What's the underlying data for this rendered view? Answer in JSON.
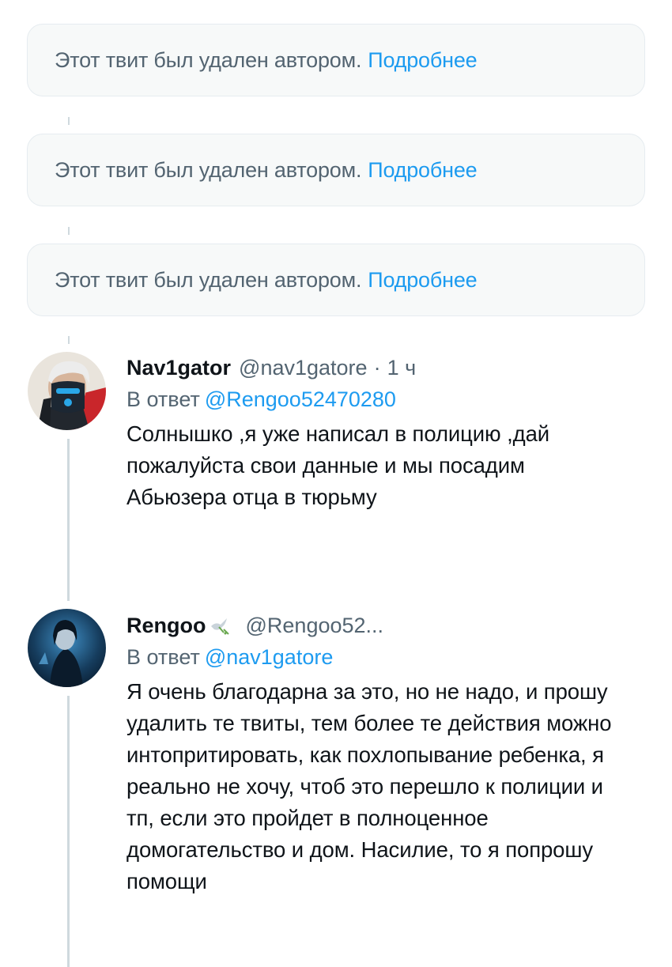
{
  "deleted_notices": [
    {
      "text": "Этот твит был удален автором.",
      "link": "Подробнее"
    },
    {
      "text": "Этот твит был удален автором.",
      "link": "Подробнее"
    },
    {
      "text": "Этот твит был удален автором.",
      "link": "Подробнее"
    }
  ],
  "tweets": [
    {
      "display_name": "Nav1gator",
      "handle": "@nav1gatore",
      "separator": "·",
      "time": "1 ч",
      "reply_prefix": "В ответ",
      "reply_mention": "@Rengoo52470280",
      "text": "Солнышко ,я уже написал в полицию ,дай пожалуйста свои данные и мы посадим Абьюзера отца в тюрьму"
    },
    {
      "display_name": "Rengoo",
      "handle": "@Rengoo52...",
      "reply_prefix": "В ответ",
      "reply_mention": "@nav1gatore",
      "text": "Я очень благодарна за это, но не надо, и прошу удалить те твиты, тем более те действия можно интопритировать, как похлопывание ребенка, я реально не хочу, чтоб это перешло к полиции и тп, если это пройдет в полноценное домогательство и дом. Насилие, то я попрошу помощи"
    }
  ],
  "colors": {
    "link": "#1d9bf0",
    "muted": "#536471",
    "text": "#0f1419",
    "notice_bg": "#f7f9f9",
    "thread_line": "#cfd9de"
  },
  "icons": {
    "avatar_1": "masked-character-avatar",
    "avatar_2": "dark-blue-portrait-avatar",
    "name_badge_2": "dove-icon"
  }
}
